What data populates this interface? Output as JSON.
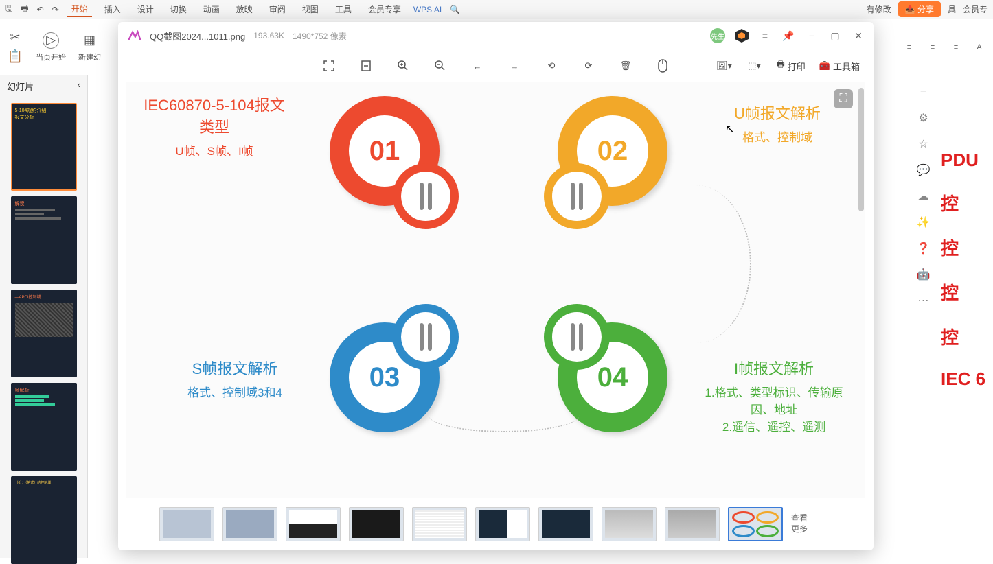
{
  "wps": {
    "tabs": [
      "开始",
      "插入",
      "设计",
      "切换",
      "动画",
      "放映",
      "审阅",
      "视图",
      "工具",
      "会员专享"
    ],
    "ai_label": "WPS AI",
    "more_tools": "具",
    "member": "会员专",
    "changes": "有修改",
    "share": "分享",
    "ribbon": {
      "cut": "✂",
      "paste": "📋",
      "play": "▷",
      "start_label": "当页开始",
      "new_slide": "新建幻",
      "indent_icons": [
        "≡",
        "≡",
        "≡",
        "A"
      ]
    },
    "slides_label": "幻灯片",
    "right_texts": [
      "PDU",
      "控",
      "控",
      "控",
      "控",
      "IEC 6"
    ]
  },
  "viewer": {
    "filename": "QQ截图2024...1011.png",
    "filesize": "193.63K",
    "dimensions": "1490*752 像素",
    "avatar_text": "先生",
    "print": "打印",
    "toolbox": "工具箱",
    "more_label": "查看\n更多"
  },
  "diagram": {
    "q1": {
      "title": "IEC60870-5-104报文类型",
      "sub": "U帧、S帧、I帧",
      "num": "01"
    },
    "q2": {
      "title": "U帧报文解析",
      "sub": "格式、控制域",
      "num": "02"
    },
    "q3": {
      "title": "S帧报文解析",
      "sub": "格式、控制域3和4",
      "num": "03"
    },
    "q4": {
      "title": "I帧报文解析",
      "sub1": "1.格式、类型标识、传输原因、地址",
      "sub2": "2.遥信、遥控、遥测",
      "num": "04"
    }
  },
  "slide_thumbs": {
    "s1": {
      "l1": "5-104规约介绍",
      "l2": "报文分析"
    },
    "s2": {
      "l1": "解读"
    },
    "s3": {
      "l1": "—APCI控制域"
    },
    "s4": {
      "l1": "帧解析"
    },
    "s5": {
      "l1": "（0）：（格式）的控制域"
    }
  }
}
